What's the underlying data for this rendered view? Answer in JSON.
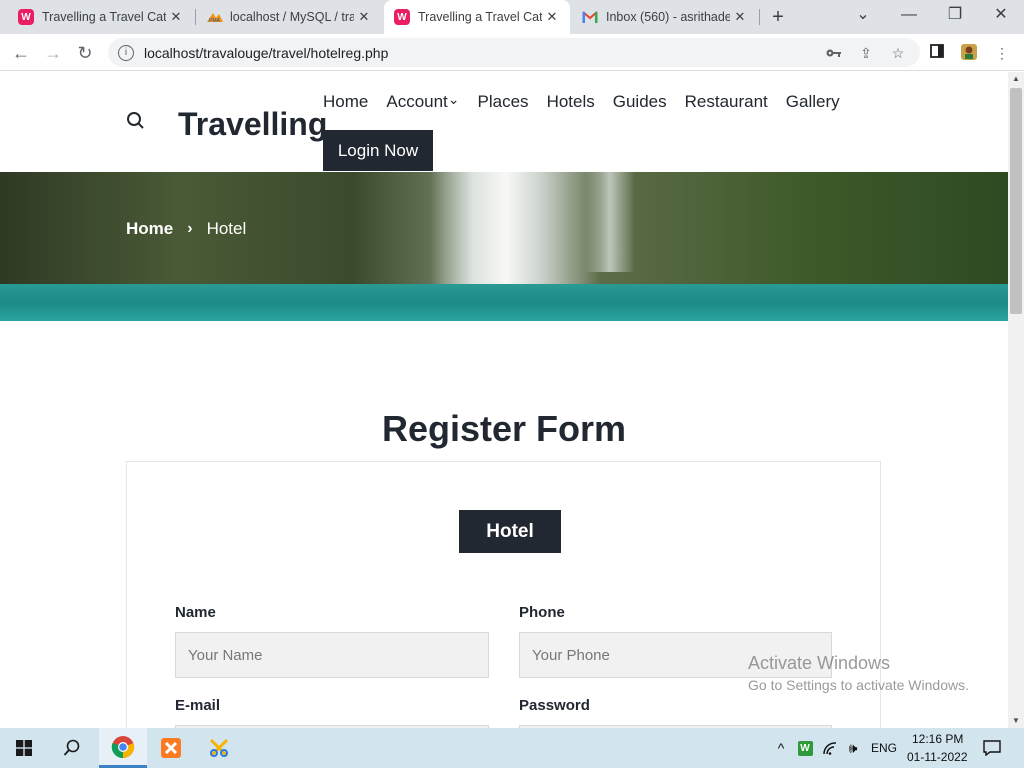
{
  "browser": {
    "tabs": [
      {
        "title": "Travelling a Travel Cate",
        "close": "✕"
      },
      {
        "title": "localhost / MySQL / tra",
        "close": "✕"
      },
      {
        "title": "Travelling a Travel Cate",
        "close": "✕"
      },
      {
        "title": "Inbox (560) - asrithade",
        "close": "✕"
      }
    ],
    "new_tab": "+",
    "window_controls": {
      "chevron": "⌄",
      "minimize": "—",
      "restore": "❐",
      "close": "✕"
    },
    "url": "localhost/travalouge/travel/hotelreg.php"
  },
  "site": {
    "logo": "Travelling",
    "nav": [
      "Home",
      "Account",
      "Places",
      "Hotels",
      "Guides",
      "Restaurant",
      "Gallery"
    ],
    "account_chevron": "⌄",
    "login_button": "Login Now",
    "breadcrumb": {
      "home": "Home",
      "separator": "›",
      "current": "Hotel"
    }
  },
  "form": {
    "title": "Register Form",
    "type_button": "Hotel",
    "fields": {
      "name": {
        "label": "Name",
        "placeholder": "Your Name"
      },
      "phone": {
        "label": "Phone",
        "placeholder": "Your Phone"
      },
      "email": {
        "label": "E-mail",
        "placeholder": ""
      },
      "password": {
        "label": "Password",
        "placeholder": ""
      }
    }
  },
  "watermark": {
    "line1": "Activate Windows",
    "line2": "Go to Settings to activate Windows."
  },
  "taskbar": {
    "language": "ENG",
    "time": "12:16 PM",
    "date": "01-11-2022"
  },
  "colors": {
    "brand_dark": "#222831",
    "tab_strip": "#dee1e6",
    "taskbar": "#d2e4ee",
    "favicon_pink": "#e91e63"
  }
}
